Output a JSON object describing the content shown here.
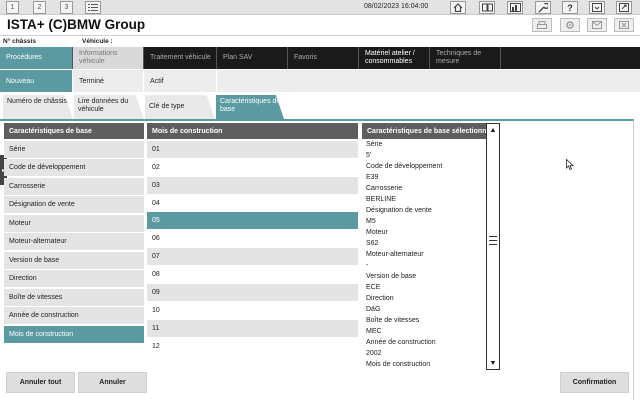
{
  "topbar": {
    "tabs": [
      "1",
      "2",
      "3"
    ],
    "datetime": "08/02/2023 16:04:00",
    "icons": [
      "list-icon",
      "home-icon",
      "book-icon",
      "chart-icon",
      "wrench-icon",
      "help-icon",
      "minimize-icon",
      "close-icon"
    ]
  },
  "app": {
    "title": "ISTA+ (C)BMW Group"
  },
  "vehicle": {
    "chassis_label": "N° châssis",
    "vehicle_label": "Véhicule :"
  },
  "nav": {
    "items": [
      "Procédures",
      "Informations véhicule",
      "Traitement véhicule",
      "Plan SAV",
      "Favoris",
      "Matériel atelier / consommables",
      "Techniques de mesure"
    ]
  },
  "subnav": {
    "items": [
      "Nouveau",
      "Terminé",
      "Actif"
    ]
  },
  "tabs": {
    "items": [
      "Numéro de châssis",
      "Lire données du véhicule",
      "Clé de type",
      "Caractéristiques de base"
    ]
  },
  "columns": {
    "characteristics_header": "Caractéristiques de base",
    "month_header": "Mois de construction",
    "selected_header": "Caractéristiques de base sélectionnées"
  },
  "characteristics": [
    "Série",
    "Code de développement",
    "Carrosserie",
    "Désignation de vente",
    "Moteur",
    "Moteur-alternateur",
    "Version de base",
    "Direction",
    "Boîte de vitesses",
    "Année de construction",
    "Mois de construction"
  ],
  "months": [
    "01",
    "02",
    "03",
    "04",
    "05",
    "06",
    "07",
    "08",
    "09",
    "10",
    "11",
    "12"
  ],
  "selected": [
    "Série",
    "5'",
    "Code de développement",
    "E39",
    "Carrosserie",
    "BERLINE",
    "Désignation de vente",
    "M5",
    "Moteur",
    "S62",
    "Moteur-alternateur",
    "-",
    "Version de base",
    "ECE",
    "Direction",
    "DäG",
    "Boîte de vitesses",
    "MEC",
    "Année de construction",
    "2002",
    "Mois de construction"
  ],
  "buttons": {
    "cancel_all": "Annuler tout",
    "cancel": "Annuler",
    "confirm": "Confirmation"
  },
  "colors": {
    "accent": "#5a9aa0",
    "nav_bg": "#1a1a1a",
    "header_bg": "#5e5e5e"
  }
}
